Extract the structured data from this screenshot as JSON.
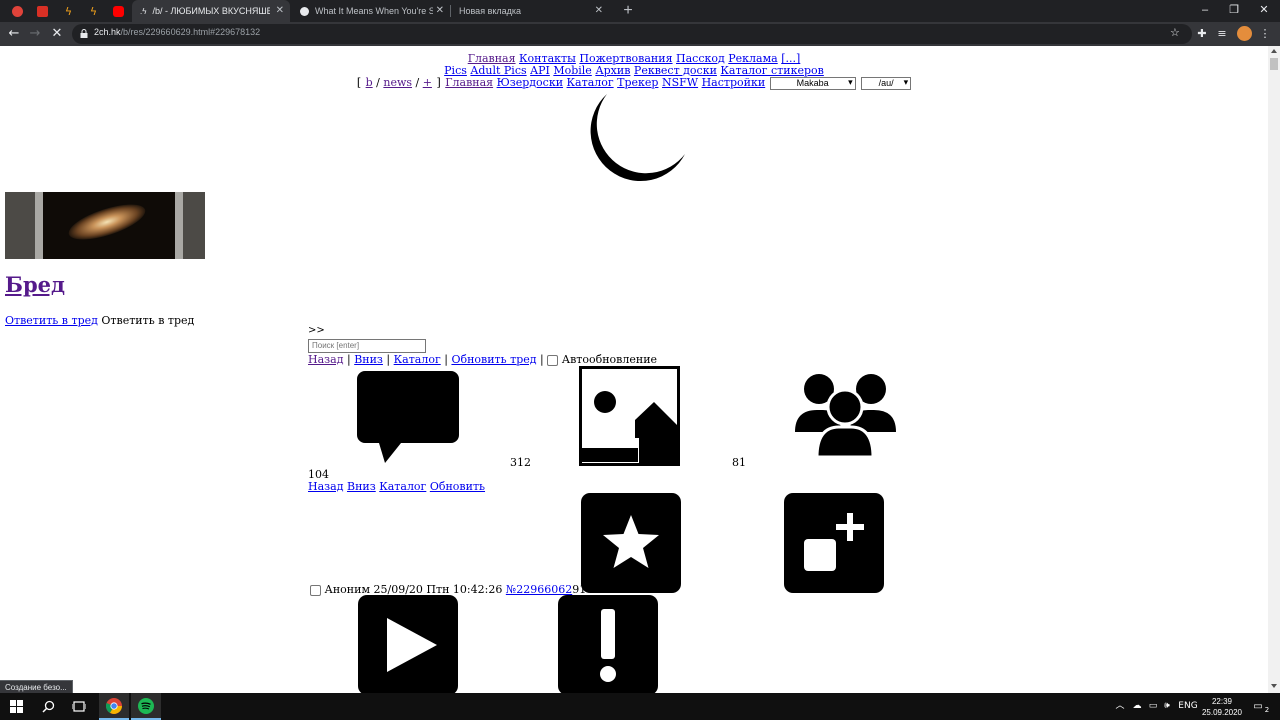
{
  "browser": {
    "tabs": [
      {
        "title": "",
        "icon": "pinned-mail-icon",
        "color": "#e0433a"
      },
      {
        "title": "",
        "icon": "pinned-pdf-icon",
        "color": "#d93025"
      },
      {
        "title": "",
        "icon": "pinned-bolt-icon",
        "color": "#f4a31c"
      },
      {
        "title": "",
        "icon": "pinned-bolt-icon",
        "color": "#f4a31c"
      },
      {
        "title": "",
        "icon": "pinned-youtube-icon",
        "color": "#ff0000"
      },
      {
        "title": "/b/ - ЛЮБИМЫХ ВКУСНЯШЕК Т",
        "active": true
      },
      {
        "title": "What It Means When You're Suic"
      },
      {
        "title": "Новая вкладка"
      }
    ],
    "new_tab": "+",
    "window_controls": {
      "minimize": "–",
      "restore": "❐",
      "close": "✕"
    },
    "url_host": "2ch.hk",
    "url_path": "/b/res/229660629.html#229678132"
  },
  "header": {
    "nav1": [
      "Главная",
      "Контакты",
      "Пожертвования",
      "Пасскод",
      "Реклама",
      "[...]"
    ],
    "nav2": [
      "Pics",
      "Adult Pics",
      "API",
      "Mobile",
      "Архив",
      "Реквест доски",
      "Каталог стикеров"
    ],
    "nav3_prefix": "[",
    "nav3_boards": [
      "b",
      "news",
      "+"
    ],
    "nav3_suffix": "]",
    "nav3_links": [
      "Главная",
      "Юзердоски",
      "Каталог",
      "Трекер",
      "NSFW",
      "Настройки"
    ],
    "style_select": "Makaba",
    "board_select": "/au/"
  },
  "board": {
    "title": "Бред",
    "reply_link": "Ответить в тред",
    "reply_text": "Ответить в тред"
  },
  "thread": {
    "arrow": ">>",
    "search_placeholder": "Поиск [enter]",
    "nav": [
      "Назад",
      "Вниз",
      "Каталог",
      "Обновить тред"
    ],
    "autoupdate": "Автообновление",
    "posts_count": "104",
    "files_count": "312",
    "posters_count": "81",
    "nav_bottom": [
      "Назад",
      "Вниз",
      "Каталог",
      "Обновить"
    ]
  },
  "post": {
    "author": "Аноним",
    "date": "25/09/20 Птн 10:42:26",
    "number_link": "№22966062",
    "number_rest": "91"
  },
  "status_tooltip": "Создание безо...",
  "taskbar": {
    "lang": "ENG",
    "time": "22:39",
    "date": "25.09.2020",
    "notifications": "2"
  }
}
